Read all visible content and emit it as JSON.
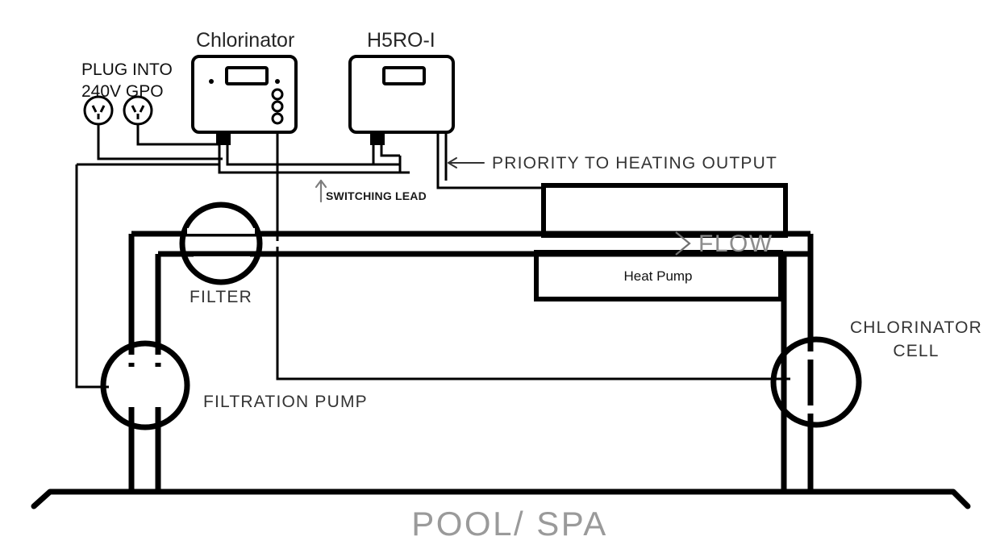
{
  "diagram": {
    "title_chlorinator": "Chlorinator",
    "title_heater": "H5RO-I",
    "plug_line1": "PLUG  INTO",
    "plug_line2": "240V  GPO",
    "priority_label": "PRIORITY  TO  HEATING  OUTPUT",
    "switching_lead_label": "SWITCHING LEAD",
    "flow_label": "FLOW",
    "heat_pump_label": "Heat Pump",
    "filter_label": "FILTER",
    "filtration_pump_label": "FILTRATION  PUMP",
    "chlorinator_cell_line1": "CHLORINATOR",
    "chlorinator_cell_line2": "CELL",
    "pool_spa_label": "POOL/ SPA"
  },
  "colors": {
    "line": "#000000",
    "flow_text": "#8c8c8c",
    "pool_text": "#9a9a9a",
    "heading_text": "#262626",
    "caps_text": "#333333",
    "arrow_gray": "#7d7d7d",
    "background": "#ffffff"
  },
  "icons": {
    "gpo_socket_left": "power-socket-icon",
    "gpo_socket_right": "power-socket-icon",
    "flow_arrow": "flow-chevron-icon",
    "switching_arrow": "arrow-up-icon",
    "priority_arrow": "arrow-left-icon"
  }
}
